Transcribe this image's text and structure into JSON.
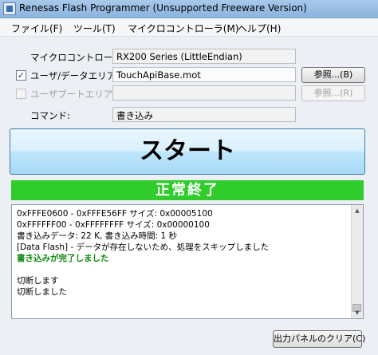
{
  "window": {
    "title": "Renesas Flash Programmer (Unsupported Freeware Version)"
  },
  "menu": [
    "ファイル(F)",
    "ツール(T)",
    "マイクロコントローラ(M)",
    "ヘルプ(H)"
  ],
  "form": {
    "mcu_label": "マイクロコントローラ:",
    "mcu_value": "RX200 Series (LittleEndian)",
    "user_area_checked": true,
    "user_area_check_mark": "✓",
    "user_area_label": "ユーザ/データエリア:",
    "user_area_value": "TouchApiBase.mot",
    "user_area_browse": "参照...(B)",
    "user_boot_checked": false,
    "user_boot_label": "ユーザブートエリア:",
    "user_boot_value": "",
    "user_boot_browse": "参照...(R)",
    "command_label": "コマンド:",
    "command_value": "書き込み"
  },
  "start_button": "スタート",
  "status": {
    "text": "正常終了",
    "color": "#2fcc2c"
  },
  "log": [
    {
      "text": " 0xFFFE0600 - 0xFFFE56FF      サイズ: 0x00005100",
      "style": "normal"
    },
    {
      "text": " 0xFFFFFF00 - 0xFFFFFFFF      サイズ: 0x00000100",
      "style": "normal"
    },
    {
      "text": "書き込みデータ: 22 K, 書き込み時間: 1 秒",
      "style": "normal"
    },
    {
      "text": "[Data Flash] - データが存在しないため、処理をスキップしました",
      "style": "normal"
    },
    {
      "text": "書き込みが完了しました",
      "style": "green"
    },
    {
      "text": "",
      "style": "normal"
    },
    {
      "text": "切断します",
      "style": "normal"
    },
    {
      "text": "切断しました",
      "style": "normal"
    }
  ],
  "clear_button": "出力パネルのクリア(C)"
}
